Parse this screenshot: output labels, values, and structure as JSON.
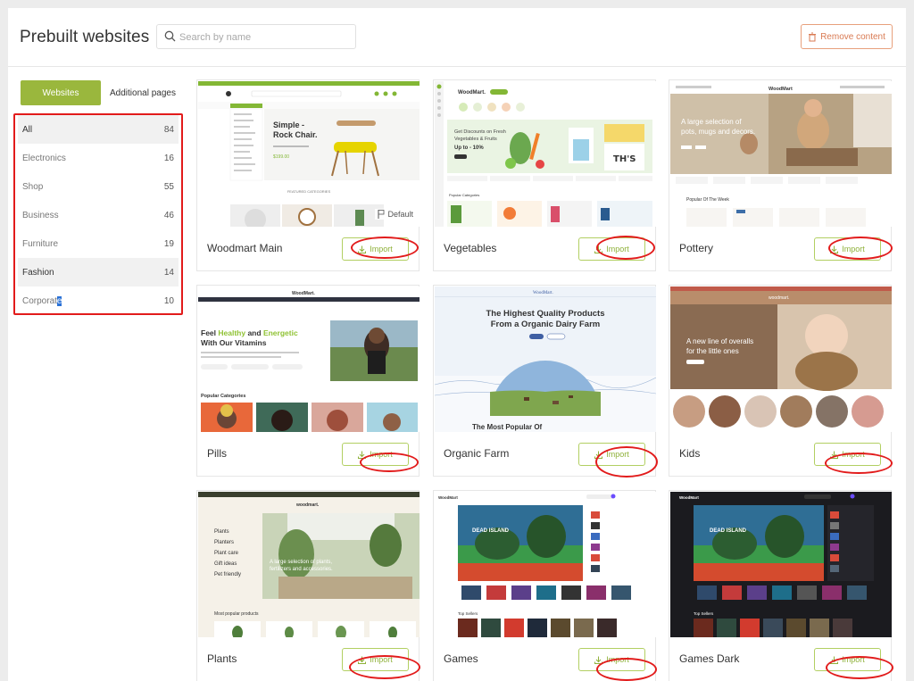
{
  "header": {
    "title": "Prebuilt websites",
    "search_placeholder": "Search by name",
    "search_value": "",
    "remove_label": "Remove content"
  },
  "sidebar": {
    "tabs": [
      {
        "label": "Websites",
        "active": true
      },
      {
        "label": "Additional pages",
        "active": false
      }
    ],
    "categories": [
      {
        "label": "All",
        "count": "84"
      },
      {
        "label": "Electronics",
        "count": "16"
      },
      {
        "label": "Shop",
        "count": "55"
      },
      {
        "label": "Business",
        "count": "46"
      },
      {
        "label": "Furniture",
        "count": "19"
      },
      {
        "label": "Fashion",
        "count": "14"
      },
      {
        "label": "Corporate",
        "count": "10"
      }
    ]
  },
  "cards": [
    {
      "title": "Woodmart Main",
      "import_label": "Import",
      "badge": "Default",
      "preview": {
        "logo": "woodmart.",
        "headline": "Simple - Rock Chair.",
        "price": "$199.00",
        "section": "FEATURED CATEGORIES"
      }
    },
    {
      "title": "Vegetables",
      "import_label": "Import",
      "preview": {
        "logo": "WoodMart.",
        "headline": "Get Discounts on Fresh Vegetables & Fruits",
        "sub": "Up to - 10%",
        "section": "Popular Categories"
      }
    },
    {
      "title": "Pottery",
      "import_label": "Import",
      "preview": {
        "logo": "WoodMart",
        "headline": "A large selection of pots, mugs and decors.",
        "section": "Popular Of The Week"
      }
    },
    {
      "title": "Pills",
      "import_label": "Import",
      "preview": {
        "logo": "WoodMart.",
        "headline_1": "Feel ",
        "headline_2": "Healthy",
        "headline_3": " and ",
        "headline_4": "Energetic",
        "headline_5": "With Our Vitamins",
        "section": "Popular Categories"
      }
    },
    {
      "title": "Organic Farm",
      "import_label": "Import",
      "preview": {
        "logo": "WoodMart.",
        "headline": "The Highest Quality Products From a Organic Dairy Farm",
        "footer": "The Most Popular Of"
      }
    },
    {
      "title": "Kids",
      "import_label": "Import",
      "preview": {
        "logo": "woodmart.",
        "headline": "A new line of overalls for the little ones"
      }
    },
    {
      "title": "Plants",
      "import_label": "Import",
      "preview": {
        "logo": "woodmart.",
        "menu": [
          "Plants",
          "Planters",
          "Plant care",
          "Gift ideas",
          "Pet friendly"
        ],
        "headline": "A large selection of plants, fertilizers and accessories.",
        "section": "Most popular products"
      }
    },
    {
      "title": "Games",
      "import_label": "Import",
      "preview": {
        "logo": "WoodMart",
        "section": "Top Sellers"
      }
    },
    {
      "title": "Games Dark",
      "import_label": "Import",
      "preview": {
        "logo": "WoodMart",
        "section": "Top Sellers"
      }
    }
  ],
  "colors": {
    "accent_green": "#9ab73d",
    "annotation_red": "#e21b1b",
    "remove_orange": "#d97a52"
  }
}
